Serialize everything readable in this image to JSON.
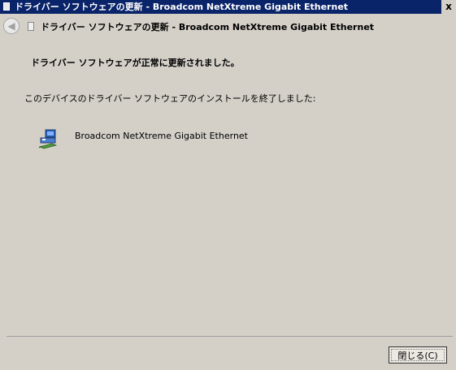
{
  "window": {
    "title": "ドライバー ソフトウェアの更新 - Broadcom NetXtreme Gigabit Ethernet",
    "close_glyph": "x"
  },
  "header": {
    "back_glyph": "◀",
    "title": "ドライバー ソフトウェアの更新 - Broadcom NetXtreme Gigabit Ethernet"
  },
  "main": {
    "heading": "ドライバー ソフトウェアが正常に更新されました。",
    "message": "このデバイスのドライバー ソフトウェアのインストールを終了しました:",
    "device_icon": "network-adapter-icon",
    "device_name": "Broadcom NetXtreme Gigabit Ethernet"
  },
  "footer": {
    "close_label": "閉じる(C)"
  },
  "colors": {
    "titlebar": "#0a246a",
    "face": "#d4d0c8"
  }
}
